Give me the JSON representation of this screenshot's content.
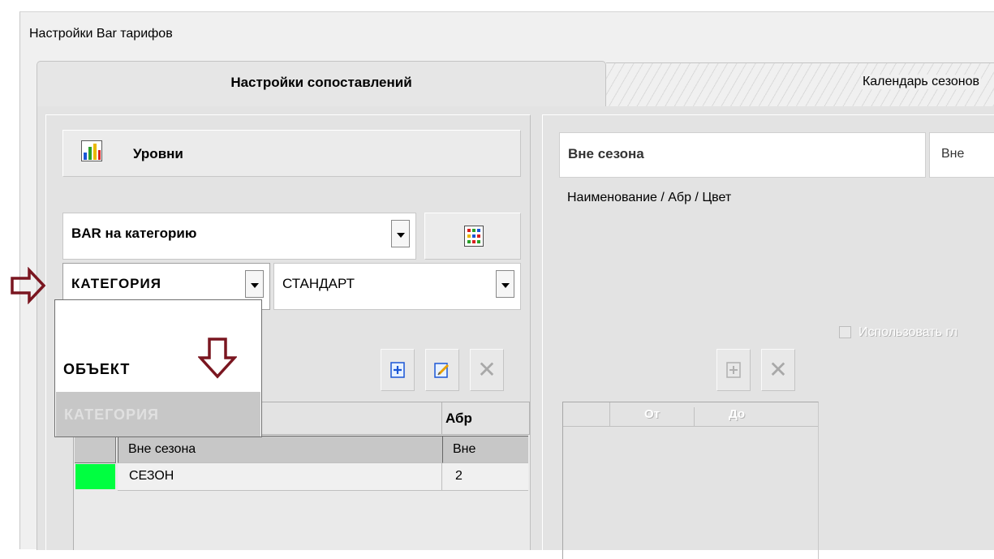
{
  "window": {
    "title": "Настройки Bar тарифов"
  },
  "tabs": [
    {
      "label": "Настройки сопоставлений",
      "active": true
    },
    {
      "label": "Календарь сезонов",
      "active": false
    }
  ],
  "left": {
    "levels_label": "Уровни",
    "bar_combo": {
      "value": "BAR на категорию"
    },
    "type_combo": {
      "value": "КАТЕГОРИЯ"
    },
    "std_combo": {
      "value": "СТАНДАРТ"
    },
    "dropdown": {
      "options": [
        "ОБЪЕКТ",
        "КАТЕГОРИЯ"
      ],
      "highlighted": "КАТЕГОРИЯ"
    },
    "table": {
      "columns": [
        "",
        "",
        "Абр"
      ],
      "rows": [
        {
          "color": "#c8c8c8",
          "name": "Вне сезона",
          "abbr": "Вне",
          "selected": true
        },
        {
          "color": "#00ff40",
          "name": "СЕЗОН",
          "abbr": "2",
          "selected": false
        }
      ]
    }
  },
  "right": {
    "name_value": "Вне сезона",
    "abbr_value": "Вне",
    "fields_label": "Наименование / Абр / Цвет",
    "checkbox_label": "Использовать гл",
    "dates_columns": [
      "От",
      "До"
    ]
  },
  "colors": {
    "annotation_arrow": "#7a1620",
    "selection": "#c7c7c7"
  }
}
